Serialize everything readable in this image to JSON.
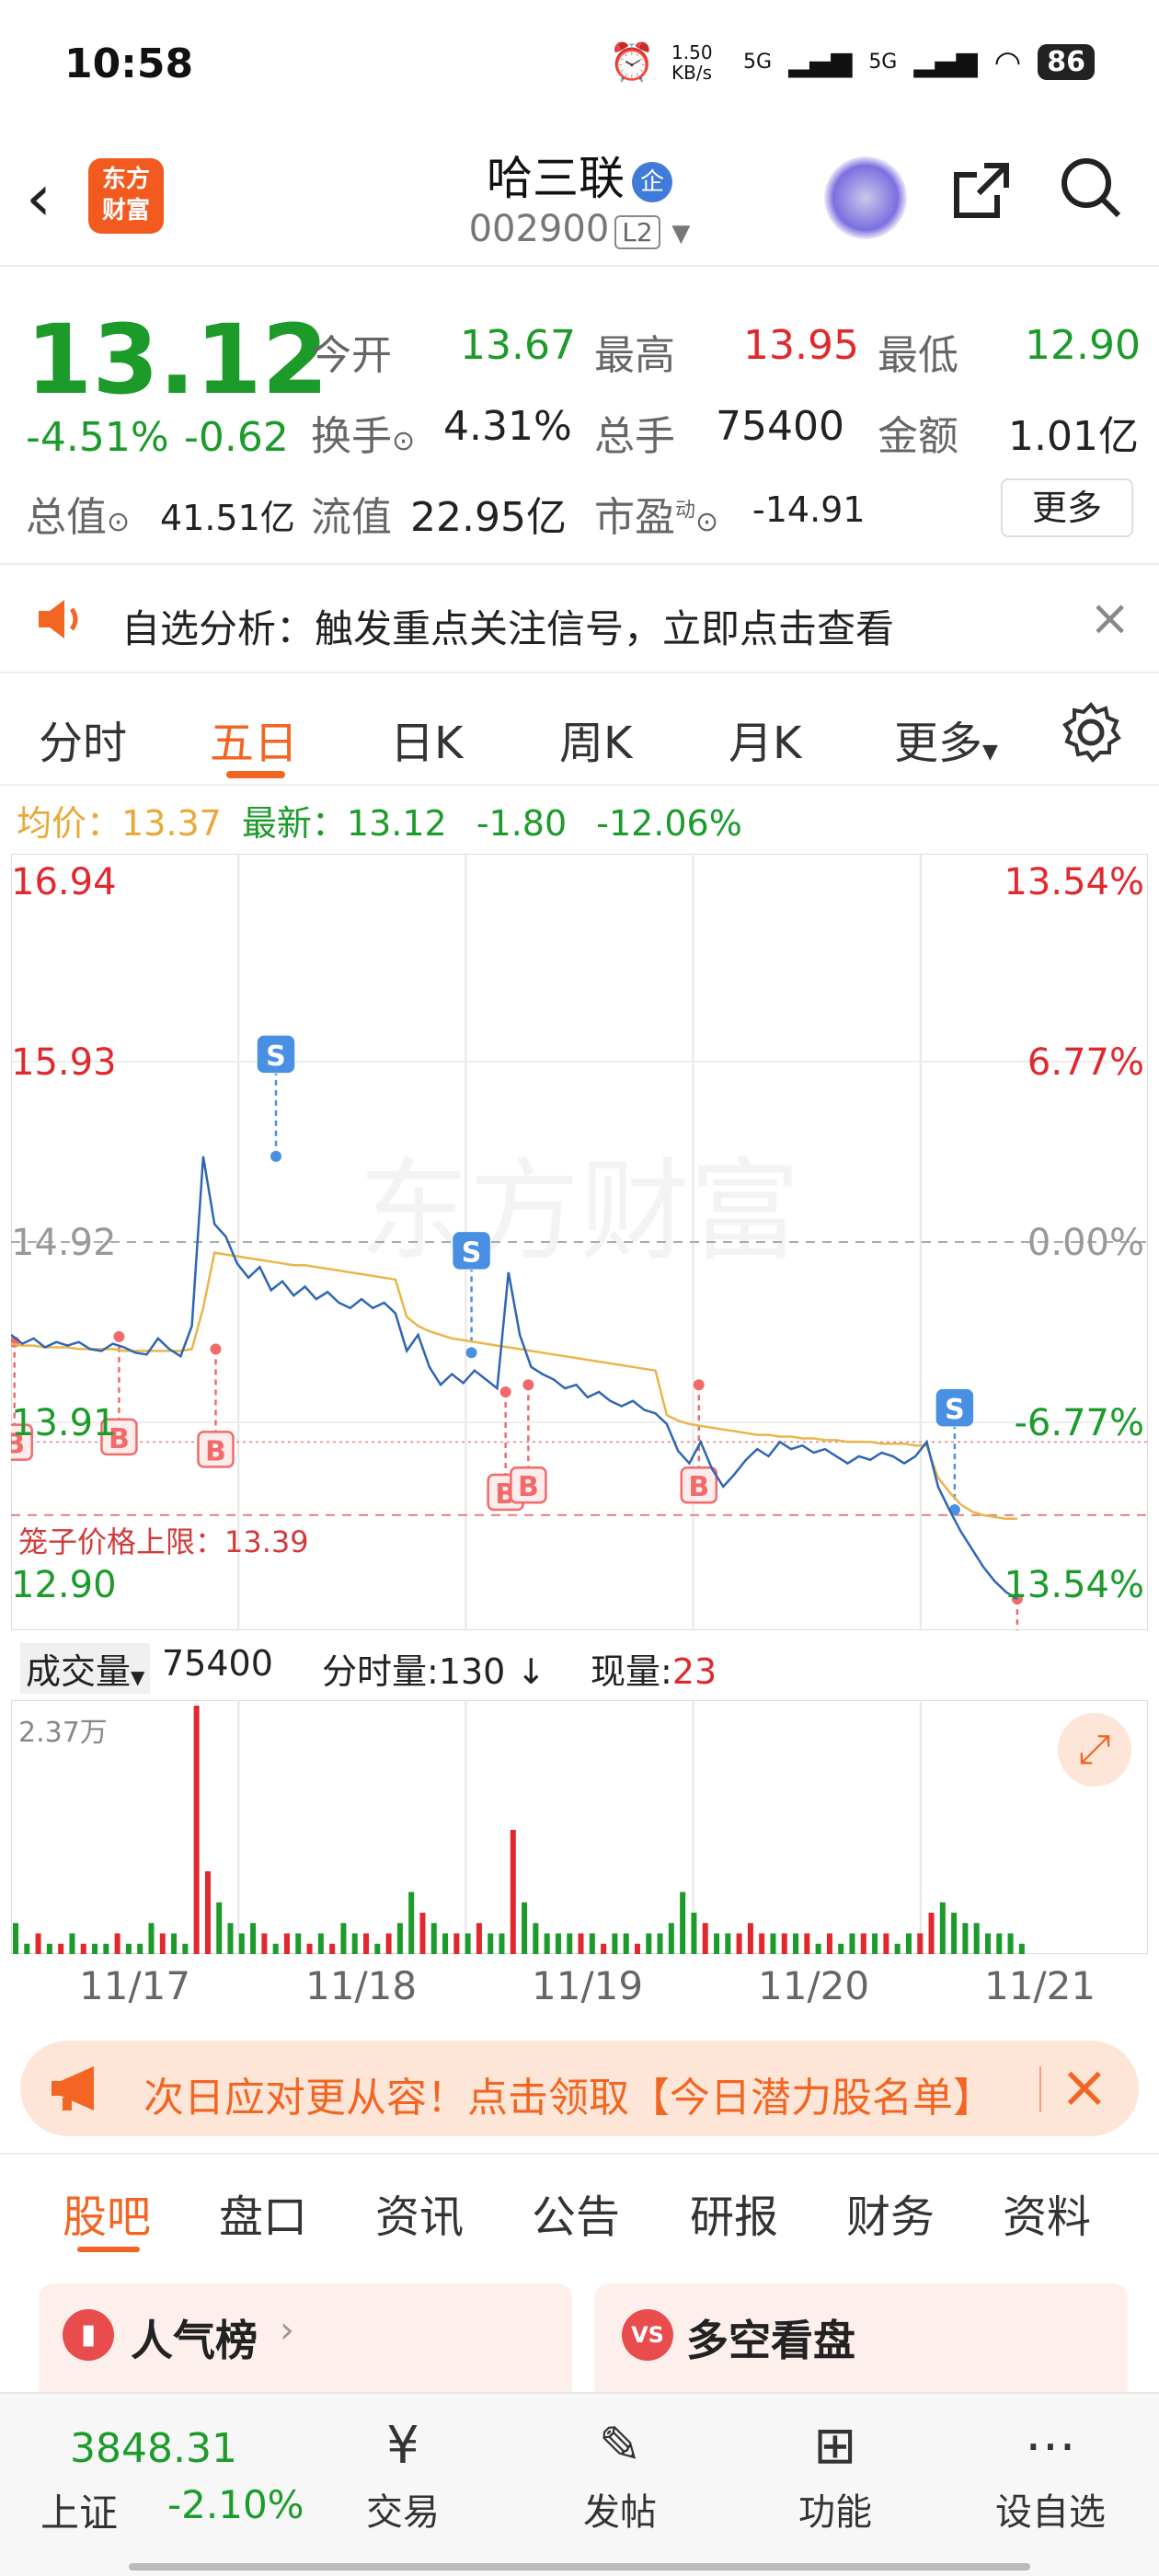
{
  "status_bar": {
    "time": "10:58",
    "net_speed": "1.50 KB/s",
    "signal1": "5G",
    "signal2": "5G",
    "battery": "86"
  },
  "header": {
    "back_icon": "chevron-left-icon",
    "logo_line1": "东方",
    "logo_line2": "财富",
    "stock_name": "哈三联",
    "badge": "企",
    "stock_code": "002900",
    "level": "L2"
  },
  "quote": {
    "price": "13.12",
    "change_pct": "-4.51%",
    "change_abs": "-0.62",
    "open_label": "今开",
    "open": "13.67",
    "high_label": "最高",
    "high": "13.95",
    "low_label": "最低",
    "low": "12.90",
    "turnover_label": "换手",
    "turnover": "4.31%",
    "volume_label": "总手",
    "volume": "75400",
    "amount_label": "金额",
    "amount": "1.01亿",
    "mcap_label": "总值",
    "mcap": "41.51亿",
    "float_label": "流值",
    "float": "22.95亿",
    "pe_label": "市盈",
    "pe_sup": "动",
    "pe": "-14.91",
    "more_label": "更多"
  },
  "notice": {
    "text": "自选分析：触发重点关注信号，立即点击查看"
  },
  "tabs": [
    "分时",
    "五日",
    "日K",
    "周K",
    "月K",
    "更多"
  ],
  "avg_line": {
    "avg_label": "均价：",
    "avg": "13.37",
    "latest_label": "最新：",
    "latest": "13.12",
    "chg": "-1.80",
    "chg_pct": "-12.06%"
  },
  "chart_data": {
    "type": "line",
    "title": "",
    "x_categories": [
      "11/17",
      "11/18",
      "11/19",
      "11/20",
      "11/21"
    ],
    "y_left_ticks": [
      "16.94",
      "15.93",
      "14.92",
      "13.91",
      "12.90"
    ],
    "y_right_ticks": [
      "13.54%",
      "6.77%",
      "0.00%",
      "-6.77%",
      "13.54%"
    ],
    "ylim": [
      12.9,
      16.94
    ],
    "watermark": "东方财富",
    "limit_label": "笼子价格上限：13.39",
    "limit_value": 13.39,
    "prev_close": 14.92,
    "price_series": [
      14.4,
      14.35,
      14.38,
      14.33,
      14.36,
      14.34,
      14.36,
      14.32,
      14.31,
      14.35,
      14.33,
      14.3,
      14.29,
      14.38,
      14.32,
      14.28,
      14.45,
      15.4,
      15.02,
      14.95,
      14.8,
      14.72,
      14.78,
      14.65,
      14.7,
      14.62,
      14.67,
      14.6,
      14.64,
      14.58,
      14.55,
      14.6,
      14.55,
      14.58,
      14.52,
      14.31,
      14.4,
      14.22,
      14.12,
      14.18,
      14.13,
      14.2,
      14.15,
      14.1,
      14.75,
      14.4,
      14.22,
      14.18,
      14.15,
      14.1,
      14.12,
      14.05,
      14.08,
      14.03,
      14.0,
      14.03,
      13.98,
      13.96,
      13.9,
      13.75,
      13.68,
      13.8,
      13.65,
      13.55,
      13.62,
      13.7,
      13.76,
      13.72,
      13.8,
      13.76,
      13.78,
      13.74,
      13.76,
      13.72,
      13.68,
      13.72,
      13.7,
      13.74,
      13.72,
      13.68,
      13.72,
      13.8,
      13.55,
      13.42,
      13.3,
      13.2,
      13.1,
      13.02,
      12.96,
      12.92
    ],
    "avg_series": [
      14.35,
      14.34,
      14.34,
      14.33,
      14.33,
      14.33,
      14.32,
      14.32,
      14.32,
      14.32,
      14.31,
      14.31,
      14.31,
      14.31,
      14.31,
      14.31,
      14.32,
      14.55,
      14.86,
      14.85,
      14.84,
      14.83,
      14.82,
      14.81,
      14.8,
      14.79,
      14.79,
      14.78,
      14.77,
      14.76,
      14.75,
      14.74,
      14.73,
      14.72,
      14.71,
      14.5,
      14.45,
      14.42,
      14.4,
      14.38,
      14.37,
      14.36,
      14.35,
      14.34,
      14.33,
      14.32,
      14.31,
      14.3,
      14.29,
      14.28,
      14.27,
      14.26,
      14.25,
      14.24,
      14.23,
      14.22,
      14.21,
      14.2,
      13.95,
      13.92,
      13.9,
      13.89,
      13.88,
      13.87,
      13.86,
      13.85,
      13.84,
      13.84,
      13.83,
      13.83,
      13.82,
      13.82,
      13.81,
      13.81,
      13.8,
      13.8,
      13.8,
      13.79,
      13.79,
      13.79,
      13.78,
      13.78,
      13.6,
      13.52,
      13.45,
      13.41,
      13.39,
      13.38,
      13.37,
      13.37
    ],
    "markers": [
      {
        "label": "B",
        "x": 0.003,
        "price": 14.36
      },
      {
        "label": "B",
        "x": 0.095,
        "price": 14.39
      },
      {
        "label": "B",
        "x": 0.18,
        "price": 14.32
      },
      {
        "label": "S",
        "x": 0.233,
        "price": 15.4
      },
      {
        "label": "S",
        "x": 0.405,
        "price": 14.3
      },
      {
        "label": "B",
        "x": 0.435,
        "price": 14.08
      },
      {
        "label": "B",
        "x": 0.455,
        "price": 14.12
      },
      {
        "label": "B",
        "x": 0.605,
        "price": 14.12
      },
      {
        "label": "S",
        "x": 0.83,
        "price": 13.42
      },
      {
        "label": "B",
        "x": 0.885,
        "price": 12.92
      }
    ]
  },
  "volume_bar": {
    "label": "成交量",
    "total": "75400",
    "fenshi_label": "分时量:",
    "fenshi": "130",
    "xianliang_label": "现量:",
    "xianliang": "23",
    "max_label": "2.37万"
  },
  "volume_data": [
    3,
    1,
    2,
    1,
    1,
    2,
    1,
    1,
    1,
    2,
    1,
    1,
    3,
    2,
    2,
    1,
    24,
    8,
    5,
    3,
    2,
    3,
    2,
    1,
    2,
    2,
    1,
    2,
    1,
    3,
    2,
    2,
    1,
    2,
    3,
    6,
    4,
    3,
    2,
    2,
    2,
    3,
    2,
    2,
    12,
    5,
    3,
    2,
    2,
    2,
    2,
    2,
    1,
    2,
    2,
    1,
    2,
    2,
    3,
    6,
    4,
    3,
    2,
    2,
    2,
    3,
    2,
    2,
    2,
    2,
    2,
    1,
    2,
    1,
    2,
    2,
    2,
    2,
    1,
    2,
    2,
    4,
    5,
    4,
    3,
    3,
    2,
    2,
    2,
    1
  ],
  "promo": {
    "text": "次日应对更从容！点击领取【今日潜力股名单】"
  },
  "bottom_tabs": [
    "股吧",
    "盘口",
    "资讯",
    "公告",
    "研报",
    "财务",
    "资料"
  ],
  "cards": [
    {
      "label": "人气榜"
    },
    {
      "label": "多空看盘"
    }
  ],
  "nav": {
    "index_value": "3848.31",
    "index_name": "上证",
    "index_chg": "-2.10%",
    "items": [
      "交易",
      "发帖",
      "功能",
      "设自选"
    ]
  },
  "colors": {
    "accent": "#f26522",
    "up": "#e0282d",
    "down": "#1c9b2b",
    "price_line": "#2f66b3",
    "avg_line": "#e8b64a"
  }
}
